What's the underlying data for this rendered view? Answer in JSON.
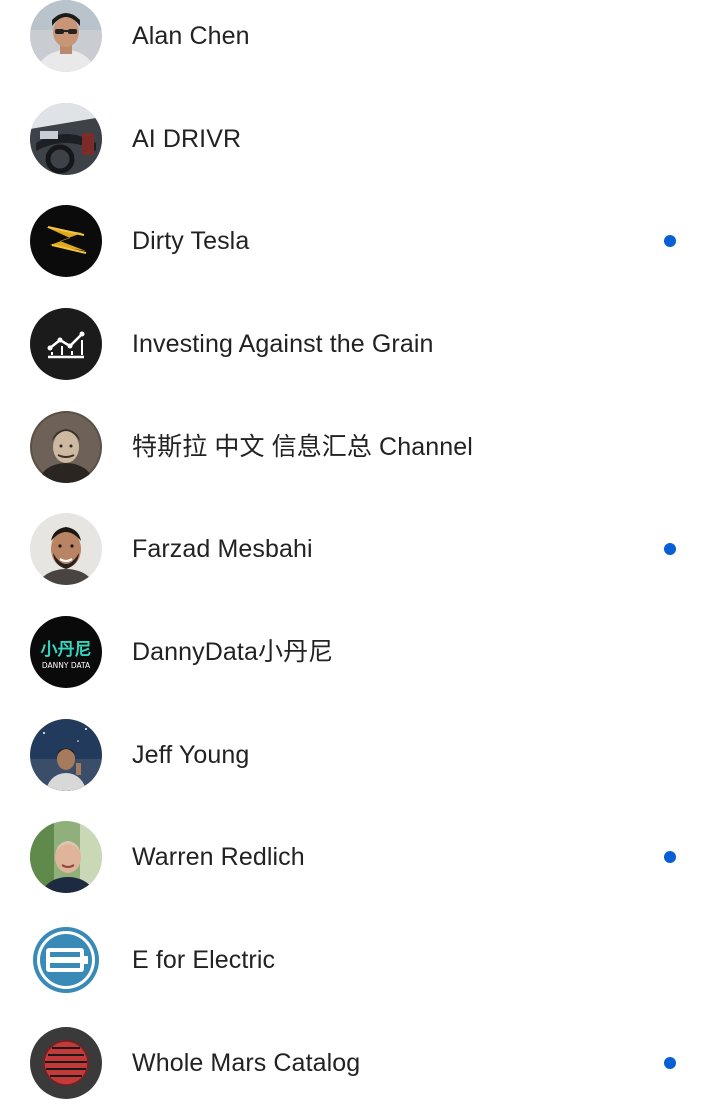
{
  "accent_color": "#065fd4",
  "channels": [
    {
      "name": "Alan Chen",
      "avatar_icon": "alan-chen-avatar",
      "has_new_content": false
    },
    {
      "name": "AI DRIVR",
      "avatar_icon": "ai-drivr-avatar",
      "has_new_content": false
    },
    {
      "name": "Dirty Tesla",
      "avatar_icon": "dirty-tesla-avatar",
      "has_new_content": true
    },
    {
      "name": "Investing Against the Grain",
      "avatar_icon": "investing-against-the-grain-avatar",
      "has_new_content": false
    },
    {
      "name": "特斯拉 中文 信息汇总 Channel",
      "avatar_icon": "tesla-chinese-channel-avatar",
      "has_new_content": false
    },
    {
      "name": "Farzad Mesbahi",
      "avatar_icon": "farzad-mesbahi-avatar",
      "has_new_content": true
    },
    {
      "name": "DannyData小丹尼",
      "avatar_icon": "dannydata-avatar",
      "has_new_content": false,
      "avatar_logo_text": [
        "小丹尼",
        "DANNY DATA"
      ]
    },
    {
      "name": "Jeff Young",
      "avatar_icon": "jeff-young-avatar",
      "has_new_content": false
    },
    {
      "name": "Warren Redlich",
      "avatar_icon": "warren-redlich-avatar",
      "has_new_content": true
    },
    {
      "name": "E for Electric",
      "avatar_icon": "e-for-electric-avatar",
      "has_new_content": false
    },
    {
      "name": "Whole Mars Catalog",
      "avatar_icon": "whole-mars-catalog-avatar",
      "has_new_content": true
    }
  ]
}
